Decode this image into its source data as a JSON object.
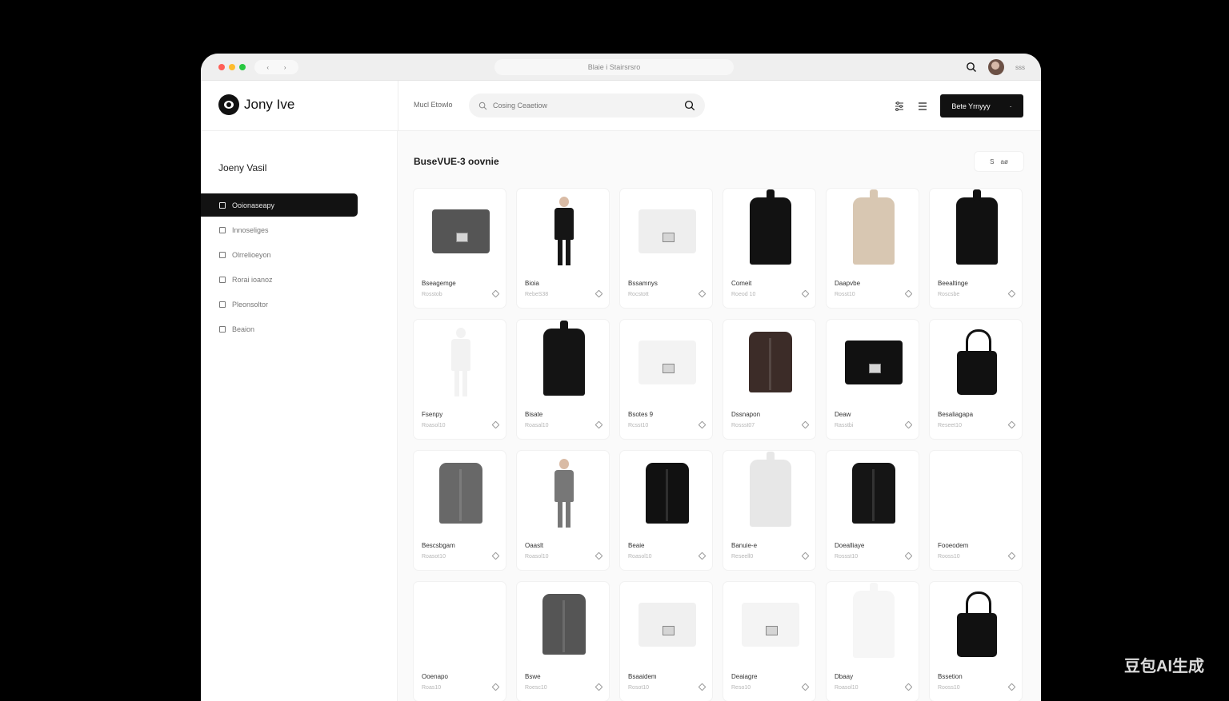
{
  "browser": {
    "url": "Blaie i Stairsrsro",
    "nav_left": "‹",
    "nav_right": "›",
    "more": "sss"
  },
  "app": {
    "brand": "Jony Ive",
    "section_label": "Mucl Etowlo",
    "search_placeholder": "Cosing Ceaetiow",
    "cta_label": "Bete Yrnyyy",
    "cta_mark": "·"
  },
  "sidebar": {
    "title": "Joeny Vasil",
    "items": [
      {
        "label": "Ooionaseapy",
        "active": true,
        "icon": "box-icon"
      },
      {
        "label": "Innoseliges",
        "active": false,
        "icon": "grid-icon"
      },
      {
        "label": "Olrrelioeyon",
        "active": false,
        "icon": "bookmark-icon"
      },
      {
        "label": "Rorai ioanoz",
        "active": false,
        "icon": "card-icon"
      },
      {
        "label": "Pleonsoltor",
        "active": false,
        "icon": "sliders-icon"
      },
      {
        "label": "Beaion",
        "active": false,
        "icon": "document-icon"
      }
    ]
  },
  "content": {
    "title": "BuseVUE-3 oovnie",
    "filter_mark": "S",
    "filter_label": "aø"
  },
  "products": [
    {
      "name": "Bseagemge",
      "meta": "Rosstob",
      "kind": "bag",
      "color": "#555"
    },
    {
      "name": "Bioia",
      "meta": "RebeS38",
      "kind": "person",
      "color": "#151515"
    },
    {
      "name": "Bssamnys",
      "meta": "Rocstott",
      "kind": "bag",
      "color": "#eeeeee"
    },
    {
      "name": "Comeit",
      "meta": "Roeod 10",
      "kind": "coat",
      "color": "#121212"
    },
    {
      "name": "Daapvbe",
      "meta": "Rosst10",
      "kind": "coat",
      "color": "#d8c7b2"
    },
    {
      "name": "Beealtinge",
      "meta": "Roscsbe",
      "kind": "coat",
      "color": "#111"
    },
    {
      "name": "Fsenpy",
      "meta": "Roasol10",
      "kind": "person",
      "color": "#f2f2f2"
    },
    {
      "name": "Bisate",
      "meta": "Roasal10",
      "kind": "coat",
      "color": "#141414"
    },
    {
      "name": "Bsotes 9",
      "meta": "Rcsst10",
      "kind": "bag",
      "color": "#f3f3f3"
    },
    {
      "name": "Dssnapon",
      "meta": "Rossst07",
      "kind": "jacket",
      "color": "#3c2c28"
    },
    {
      "name": "Deaw",
      "meta": "Rasstbi",
      "kind": "bag",
      "color": "#111"
    },
    {
      "name": "Besaliagapa",
      "meta": "Reseet10",
      "kind": "tote",
      "color": "#111"
    },
    {
      "name": "Bescsbgam",
      "meta": "Roasot10",
      "kind": "jacket",
      "color": "#686868"
    },
    {
      "name": "Oaaslt",
      "meta": "Roasol10",
      "kind": "person",
      "color": "#777"
    },
    {
      "name": "Beaie",
      "meta": "Roasol10",
      "kind": "jacket",
      "color": "#111"
    },
    {
      "name": "Banuie-e",
      "meta": "Reseell0",
      "kind": "coat",
      "color": "#e7e7e7"
    },
    {
      "name": "Doealliaye",
      "meta": "Rossst10",
      "kind": "jacket",
      "color": "#151515"
    },
    {
      "name": "Fooeodem",
      "meta": "Rooss10",
      "kind": "empty",
      "color": "#fff"
    },
    {
      "name": "Ooenapo",
      "meta": "Roas10",
      "kind": "empty",
      "color": "#fff"
    },
    {
      "name": "Bswe",
      "meta": "Roesc10",
      "kind": "jacket",
      "color": "#555"
    },
    {
      "name": "Bsaaidem",
      "meta": "Rosot10",
      "kind": "bag",
      "color": "#f0f0f0"
    },
    {
      "name": "Deaiagre",
      "meta": "Reso10",
      "kind": "bag",
      "color": "#f4f4f4"
    },
    {
      "name": "Dbaay",
      "meta": "Roasol10",
      "kind": "coat",
      "color": "#f6f6f6"
    },
    {
      "name": "Bssetion",
      "meta": "Rooss10",
      "kind": "tote",
      "color": "#111"
    }
  ],
  "colors": {
    "accent": "#111111",
    "background": "#fafafa",
    "window_dots": [
      "#ff5f57",
      "#febc2e",
      "#28c840"
    ]
  },
  "watermark": "豆包AI生成"
}
